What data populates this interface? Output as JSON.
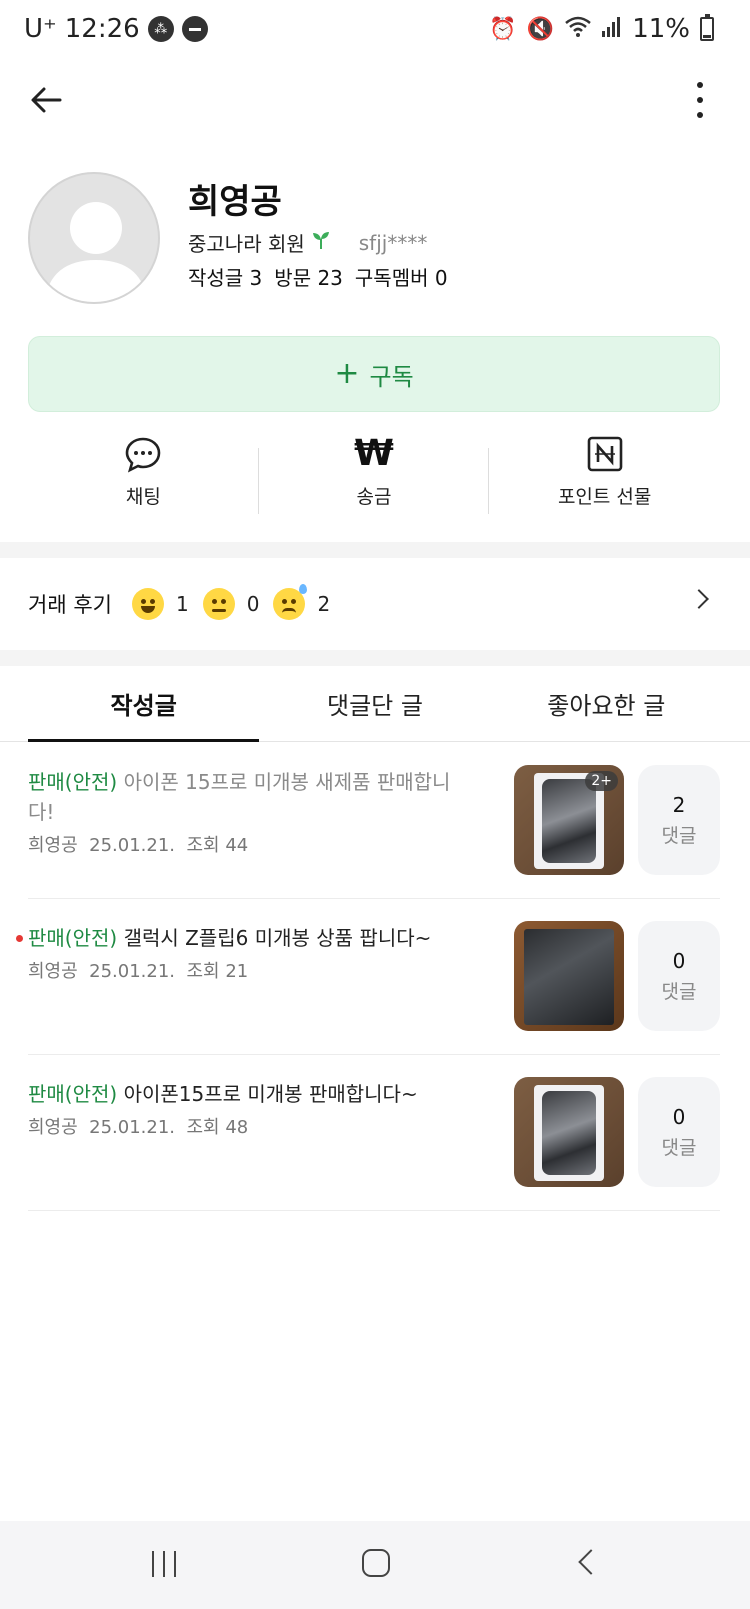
{
  "status_bar": {
    "carrier": "U⁺",
    "time": "12:26",
    "battery": "11%"
  },
  "profile": {
    "name": "희영공",
    "membership": "중고나라 회원",
    "user_id": "sfjj****",
    "stats": [
      "작성글 3",
      "방문 23",
      "구독멤버 0"
    ]
  },
  "subscribe_label": "구독",
  "actions": [
    {
      "label": "채팅",
      "icon": "chat-bubble-icon"
    },
    {
      "label": "송금",
      "icon": "won-icon"
    },
    {
      "label": "포인트 선물",
      "icon": "naver-point-icon"
    }
  ],
  "reviews": {
    "title": "거래 후기",
    "items": [
      {
        "icon": "happy-face-icon",
        "count": "1"
      },
      {
        "icon": "neutral-face-icon",
        "count": "0"
      },
      {
        "icon": "sad-face-icon",
        "count": "2"
      }
    ]
  },
  "tabs": [
    "작성글",
    "댓글단 글",
    "좋아요한 글"
  ],
  "active_tab": "작성글",
  "posts": [
    {
      "category": "판매(안전)",
      "title": "아이폰 15프로 미개봉 새제품 판매합니다!",
      "author": "희영공",
      "date": "25.01.21.",
      "views": "조회 44",
      "comments": "2",
      "comment_label": "댓글",
      "image_badge": "2+",
      "read": true
    },
    {
      "category": "판매(안전)",
      "title": "갤럭시 Z플립6 미개봉 상품 팝니다~",
      "author": "희영공",
      "date": "25.01.21.",
      "views": "조회 21",
      "comments": "0",
      "comment_label": "댓글",
      "read": false,
      "new": true
    },
    {
      "category": "판매(안전)",
      "title": "아이폰15프로 미개봉 판매합니다~",
      "author": "희영공",
      "date": "25.01.21.",
      "views": "조회 48",
      "comments": "0",
      "comment_label": "댓글",
      "read": false
    }
  ],
  "colors": {
    "accent_green": "#1f8a43",
    "subscribe_bg": "#e2f6e9",
    "new_dot": "#e53935"
  }
}
